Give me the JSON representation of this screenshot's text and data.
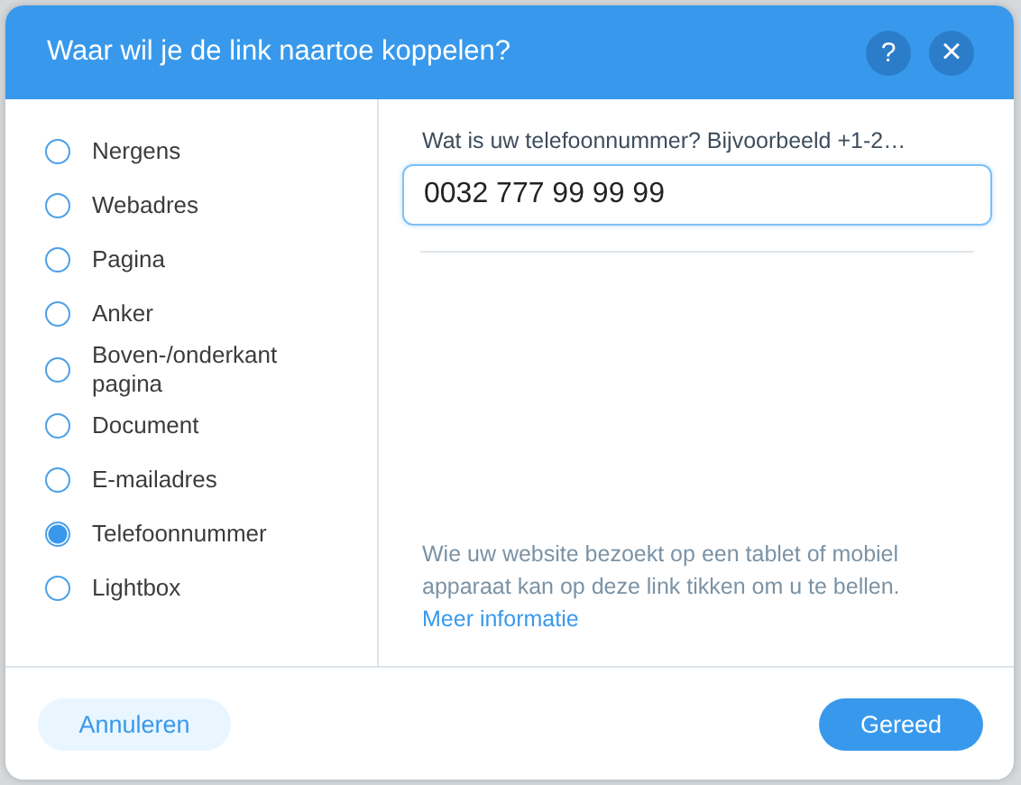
{
  "dialog": {
    "title": "Waar wil je de link naartoe koppelen?",
    "help_button": "?",
    "close_button": "×"
  },
  "options": [
    {
      "label": "Nergens",
      "selected": false
    },
    {
      "label": "Webadres",
      "selected": false
    },
    {
      "label": "Pagina",
      "selected": false
    },
    {
      "label": "Anker",
      "selected": false
    },
    {
      "label": "Boven-/onderkant pagina",
      "selected": false
    },
    {
      "label": "Document",
      "selected": false
    },
    {
      "label": "E-mailadres",
      "selected": false
    },
    {
      "label": "Telefoonnummer",
      "selected": true
    },
    {
      "label": "Lightbox",
      "selected": false
    }
  ],
  "phone": {
    "label": "Wat is uw telefoonnummer? Bijvoorbeeld +1-2…",
    "value": "0032 777 99 99 99"
  },
  "info": {
    "text": "Wie uw website bezoekt op een tablet of mobiel apparaat kan op deze link tikken om u te bellen.",
    "link": "Meer informatie"
  },
  "buttons": {
    "cancel": "Annuleren",
    "done": "Gereed"
  }
}
